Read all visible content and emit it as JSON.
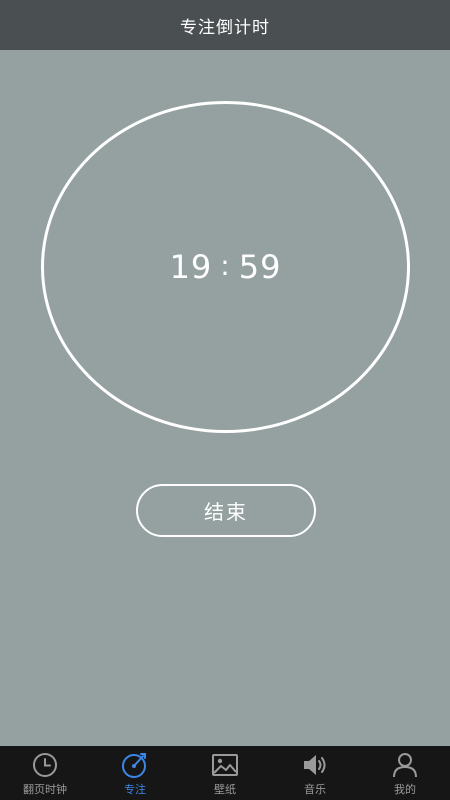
{
  "header": {
    "title": "专注倒计时"
  },
  "timer": {
    "minutes": "19",
    "separator": ":",
    "seconds": "59"
  },
  "actions": {
    "end_label": "结束"
  },
  "tabbar": {
    "active_color": "#3d86e6",
    "inactive_color": "#9a9a9a",
    "items": [
      {
        "label": "翻页时钟",
        "icon": "clock-icon",
        "active": false
      },
      {
        "label": "专注",
        "icon": "focus-icon",
        "active": true
      },
      {
        "label": "壁纸",
        "icon": "image-icon",
        "active": false
      },
      {
        "label": "音乐",
        "icon": "speaker-icon",
        "active": false
      },
      {
        "label": "我的",
        "icon": "user-icon",
        "active": false
      }
    ]
  }
}
